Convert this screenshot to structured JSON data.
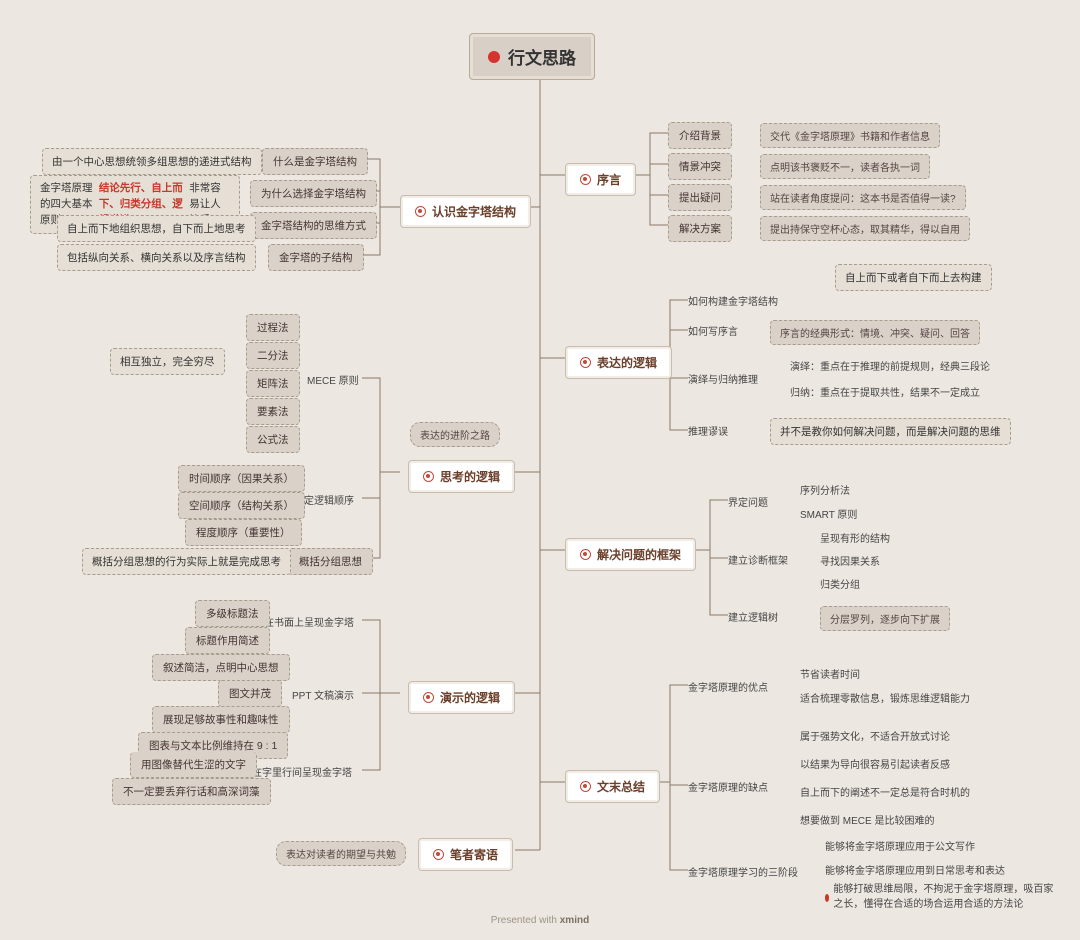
{
  "root": "行文思路",
  "sections": {
    "s1": "认识金字塔结构",
    "s2": "思考的逻辑",
    "s3": "演示的逻辑",
    "s4": "笔者寄语",
    "s5": "序言",
    "s6": "表达的逻辑",
    "s7": "解决问题的框架",
    "s8": "文末总结"
  },
  "s1_leaves": {
    "a": "什么是金字塔结构",
    "b": "为什么选择金字塔结构",
    "c": "金字塔结构的思维方式",
    "d": "金字塔的子结构"
  },
  "s1_notes": {
    "a": "由一个中心思想统领多组思想的递进式结构",
    "b1": "金字塔原理的四大基本原则：",
    "b2": "结论先行、自上而下、归类分组、逻辑递进。",
    "b3": "非常容易让人接受。",
    "c": "自上而下地组织思想，自下而上地思考",
    "d": "包括纵向关系、横向关系以及序言结构"
  },
  "s2_path_label": "表达的进阶之路",
  "s2_mece_title": "MECE 原则",
  "s2_mece_anno": "相互独立，完全穷尽",
  "s2_mece_items": [
    "过程法",
    "二分法",
    "矩阵法",
    "要素法",
    "公式法"
  ],
  "s2_order_title": "确定逻辑顺序",
  "s2_order_items": [
    "时间顺序（因果关系）",
    "空间顺序（结构关系）",
    "程度顺序（重要性）"
  ],
  "s2_group": "概括分组思想",
  "s2_group_note": "概括分组思想的行为实际上就是完成思考",
  "s3_a_title": "在书面上呈现金字塔",
  "s3_a_items": [
    "多级标题法",
    "标题作用简述"
  ],
  "s3_b_title": "PPT 文稿演示",
  "s3_b_items": [
    "叙述简洁，点明中心思想",
    "图文并茂",
    "展现足够故事性和趣味性",
    "图表与文本比例维持在 9 : 1"
  ],
  "s3_c_title": "在字里行间呈现金字塔",
  "s3_c_items": [
    "用图像替代生涩的文字",
    "不一定要丢弃行话和高深词藻"
  ],
  "s4_note": "表达对读者的期望与共勉",
  "s5_items": {
    "a": {
      "l": "介绍背景",
      "r": "交代《金字塔原理》书籍和作者信息"
    },
    "b": {
      "l": "情景冲突",
      "r": "点明该书褒贬不一，读者各执一词"
    },
    "c": {
      "l": "提出疑问",
      "r": "站在读者角度提问：这本书是否值得一读?"
    },
    "d": {
      "l": "解决方案",
      "r": "提出持保守空杯心态，取其精华，得以自用"
    }
  },
  "s6_items": {
    "a": {
      "l": "如何构建金字塔结构",
      "note": "自上而下或者自下而上去构建"
    },
    "b": {
      "l": "如何写序言",
      "r": "序言的经典形式：情境、冲突、疑问、回答"
    },
    "c": {
      "l": "演绎与归纳推理",
      "r1": "演绎：重点在于推理的前提规则，经典三段论",
      "r2": "归纳：重点在于提取共性，结果不一定成立"
    },
    "d": {
      "l": "推理谬误",
      "note": "并不是教你如何解决问题，而是解决问题的思维"
    }
  },
  "s7_items": {
    "a": {
      "l": "界定问题",
      "r1": "序列分析法",
      "r2": "SMART 原则"
    },
    "b": {
      "l": "建立诊断框架",
      "r1": "呈现有形的结构",
      "r2": "寻找因果关系",
      "r3": "归类分组"
    },
    "c": {
      "l": "建立逻辑树",
      "r": "分层罗列，逐步向下扩展"
    }
  },
  "s8_items": {
    "a": {
      "l": "金字塔原理的优点",
      "r1": "节省读者时间",
      "r2": "适合梳理零散信息，锻炼思维逻辑能力"
    },
    "b": {
      "l": "金字塔原理的缺点",
      "r1": "属于强势文化，不适合开放式讨论",
      "r2": "以结果为导向很容易引起读者反感",
      "r3": "自上而下的阐述不一定总是符合时机的",
      "r4": "想要做到 MECE 是比较困难的"
    },
    "c": {
      "l": "金字塔原理学习的三阶段",
      "r1": "能够将金字塔原理应用于公文写作",
      "r2": "能够将金字塔原理应用到日常思考和表达",
      "r3": "能够打破思维局限，不拘泥于金字塔原理，吸百家之长，懂得在合适的场合运用合适的方法论"
    }
  },
  "footer": {
    "pre": "Presented with ",
    "brand": "xmind"
  }
}
